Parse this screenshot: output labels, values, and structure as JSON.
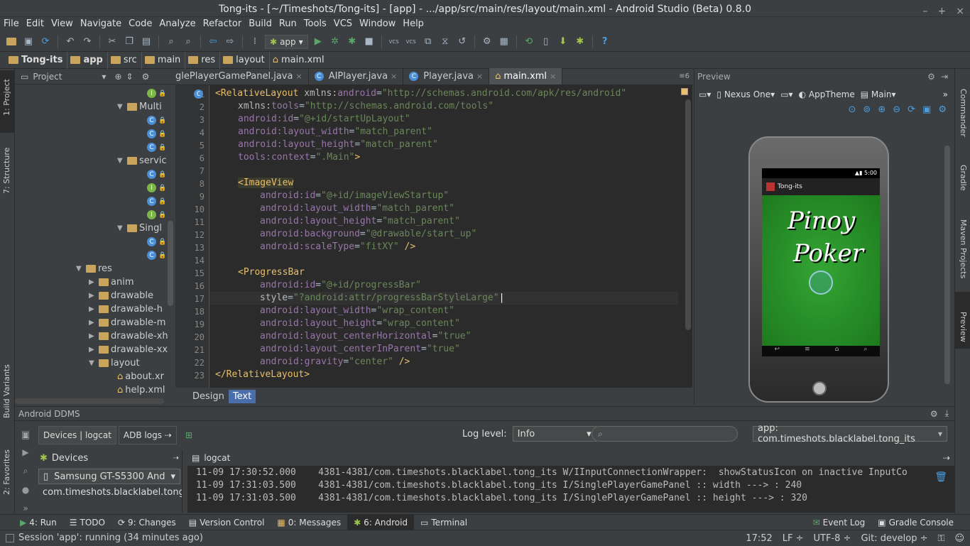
{
  "window": {
    "title": "Tong-its - [~/Timeshots/Tong-its] - [app] - .../app/src/main/res/layout/main.xml - Android Studio (Beta) 0.8.0"
  },
  "menu": [
    "File",
    "Edit",
    "View",
    "Navigate",
    "Code",
    "Analyze",
    "Refactor",
    "Build",
    "Run",
    "Tools",
    "VCS",
    "Window",
    "Help"
  ],
  "toolbar": {
    "run_config": "app",
    "vcs1": "VCS",
    "vcs2": "VCS",
    "help": "?"
  },
  "breadcrumb": [
    "Tong-its",
    "app",
    "src",
    "main",
    "res",
    "layout",
    "main.xml"
  ],
  "left_strip": {
    "project": "1: Project",
    "structure": "7: Structure",
    "build_variants": "Build Variants",
    "favorites": "2: Favorites"
  },
  "right_strip": {
    "commander": "Commander",
    "gradle": "Gradle",
    "maven": "Maven Projects",
    "preview": "Preview"
  },
  "project_panel": {
    "title": "Project",
    "items": [
      {
        "label": "",
        "type": "interface"
      },
      {
        "label": "Multi",
        "type": "folder"
      },
      {
        "label": "",
        "type": "class"
      },
      {
        "label": "",
        "type": "class"
      },
      {
        "label": "",
        "type": "class"
      },
      {
        "label": "servic",
        "type": "folder"
      },
      {
        "label": "",
        "type": "class"
      },
      {
        "label": "",
        "type": "interface"
      },
      {
        "label": "",
        "type": "class"
      },
      {
        "label": "",
        "type": "interface"
      },
      {
        "label": "Singl",
        "type": "folder"
      },
      {
        "label": "",
        "type": "class"
      },
      {
        "label": "",
        "type": "class"
      },
      {
        "label": "res",
        "type": "res"
      },
      {
        "label": "anim",
        "type": "dir"
      },
      {
        "label": "drawable",
        "type": "dir"
      },
      {
        "label": "drawable-h",
        "type": "dir"
      },
      {
        "label": "drawable-m",
        "type": "dir"
      },
      {
        "label": "drawable-xh",
        "type": "dir"
      },
      {
        "label": "drawable-xx",
        "type": "dir"
      },
      {
        "label": "layout",
        "type": "diropen"
      },
      {
        "label": "about.xr",
        "type": "xml"
      },
      {
        "label": "help.xml",
        "type": "xml"
      }
    ]
  },
  "tabs": [
    {
      "label": "glePlayerGamePanel.java",
      "active": false,
      "icon": ""
    },
    {
      "label": "AIPlayer.java",
      "active": false,
      "icon": "C"
    },
    {
      "label": "Player.java",
      "active": false,
      "icon": "C"
    },
    {
      "label": "main.xml",
      "active": true,
      "icon": ""
    }
  ],
  "tabs_count": "6",
  "editor": {
    "line_numbers": [
      "1",
      "2",
      "3",
      "4",
      "5",
      "6",
      "7",
      "8",
      "9",
      "10",
      "11",
      "12",
      "13",
      "14",
      "15",
      "16",
      "17",
      "18",
      "19",
      "20",
      "21",
      "22",
      "23"
    ],
    "gutter_icon": "C",
    "l1": {
      "open": "<RelativeLayout ",
      "attr": "xmlns:",
      "name": "android",
      "eq": "=",
      "val": "\"http://schemas.android.com/apk/res/android\""
    },
    "l2": {
      "attr": "xmlns:",
      "name": "tools",
      "eq": "=",
      "val": "\"http://schemas.android.com/tools\""
    },
    "l3": {
      "attr": "android:",
      "name": "id",
      "eq": "=",
      "val": "\"@+id/startUpLayout\""
    },
    "l4": {
      "attr": "android:",
      "name": "layout_width",
      "eq": "=",
      "val": "\"match_parent\""
    },
    "l5": {
      "attr": "android:",
      "name": "layout_height",
      "eq": "=",
      "val": "\"match_parent\""
    },
    "l6": {
      "attr": "tools:",
      "name": "context",
      "eq": "=",
      "val": "\".Main\"",
      "close": ">"
    },
    "l8": {
      "tag": "<ImageView"
    },
    "l9": {
      "attr": "android:",
      "name": "id",
      "eq": "=",
      "val": "\"@+id/imageViewStartup\""
    },
    "l10": {
      "attr": "android:",
      "name": "layout_width",
      "eq": "=",
      "val": "\"match_parent\""
    },
    "l11": {
      "attr": "android:",
      "name": "layout_height",
      "eq": "=",
      "val": "\"match_parent\""
    },
    "l12": {
      "attr": "android:",
      "name": "background",
      "eq": "=",
      "val": "\"@drawable/start_up\""
    },
    "l13": {
      "attr": "android:",
      "name": "scaleType",
      "eq": "=",
      "val": "\"fitXY\"",
      "close": " />"
    },
    "l15": {
      "tag": "<ProgressBar"
    },
    "l16": {
      "attr": "android:",
      "name": "id",
      "eq": "=",
      "val": "\"@+id/progressBar\""
    },
    "l17": {
      "attr": "",
      "name": "style",
      "eq": "=",
      "val": "\"?android:attr/progressBarStyleLarge\""
    },
    "l18": {
      "attr": "android:",
      "name": "layout_width",
      "eq": "=",
      "val": "\"wrap_content\""
    },
    "l19": {
      "attr": "android:",
      "name": "layout_height",
      "eq": "=",
      "val": "\"wrap_content\""
    },
    "l20": {
      "attr": "android:",
      "name": "layout_centerHorizontal",
      "eq": "=",
      "val": "\"true\""
    },
    "l21": {
      "attr": "android:",
      "name": "layout_centerInParent",
      "eq": "=",
      "val": "\"true\""
    },
    "l22": {
      "attr": "android:",
      "name": "gravity",
      "eq": "=",
      "val": "\"center\"",
      "close": " />"
    },
    "l23": {
      "tag": "</RelativeLayout>"
    }
  },
  "design_tabs": {
    "design": "Design",
    "text": "Text"
  },
  "preview": {
    "title": "Preview",
    "device": "Nexus One",
    "theme": "AppTheme",
    "activity": "Main",
    "status_time": "5:00",
    "app_title": "Tong-its",
    "logo_line1": "Pinoy",
    "logo_line2": "Poker"
  },
  "ddms": {
    "title": "Android DDMS",
    "tab_devices": "Devices | logcat",
    "tab_adb": "ADB logs",
    "log_level_label": "Log level:",
    "log_level_value": "Info",
    "search_placeholder": "",
    "app_filter": "app: com.timeshots.blacklabel.tong_its",
    "devices_title": "Devices",
    "device_name": "Samsung GT-S5300 And",
    "process": "com.timeshots.blacklabel.tong",
    "logcat_title": "logcat",
    "log_lines": [
      "11-09 17:30:52.000    4381-4381/com.timeshots.blacklabel.tong_its W/IInputConnectionWrapper:  showStatusIcon on inactive InputCo",
      "11-09 17:31:03.500    4381-4381/com.timeshots.blacklabel.tong_its I/SinglePlayerGamePanel :: width ---> : 240",
      "11-09 17:31:03.500    4381-4381/com.timeshots.blacklabel.tong_its I/SinglePlayerGamePanel :: height ---> : 320"
    ]
  },
  "tool_windows": [
    {
      "label": "4: Run",
      "icon": "▶"
    },
    {
      "label": "TODO",
      "icon": "☰"
    },
    {
      "label": "9: Changes",
      "icon": "⟳"
    },
    {
      "label": "Version Control",
      "icon": "▤"
    },
    {
      "label": "0: Messages",
      "icon": "▦"
    },
    {
      "label": "6: Android",
      "icon": "✱",
      "active": true
    },
    {
      "label": "Terminal",
      "icon": "▭"
    }
  ],
  "tool_windows_right": [
    {
      "label": "Event Log",
      "icon": "✉"
    },
    {
      "label": "Gradle Console",
      "icon": "▣"
    }
  ],
  "statusbar": {
    "message": "Session 'app': running (34 minutes ago)",
    "position": "17:52",
    "line_sep": "LF ÷",
    "encoding": "UTF-8 ÷",
    "git": "Git: develop ÷"
  },
  "colors": {
    "tag": "#e8bf6a",
    "attr_ns": "#9876aa",
    "string": "#6a8759",
    "bg_editor": "#2b2b2b",
    "bg_panel": "#3c3f41",
    "selected_tab": "#4a6ea9"
  }
}
